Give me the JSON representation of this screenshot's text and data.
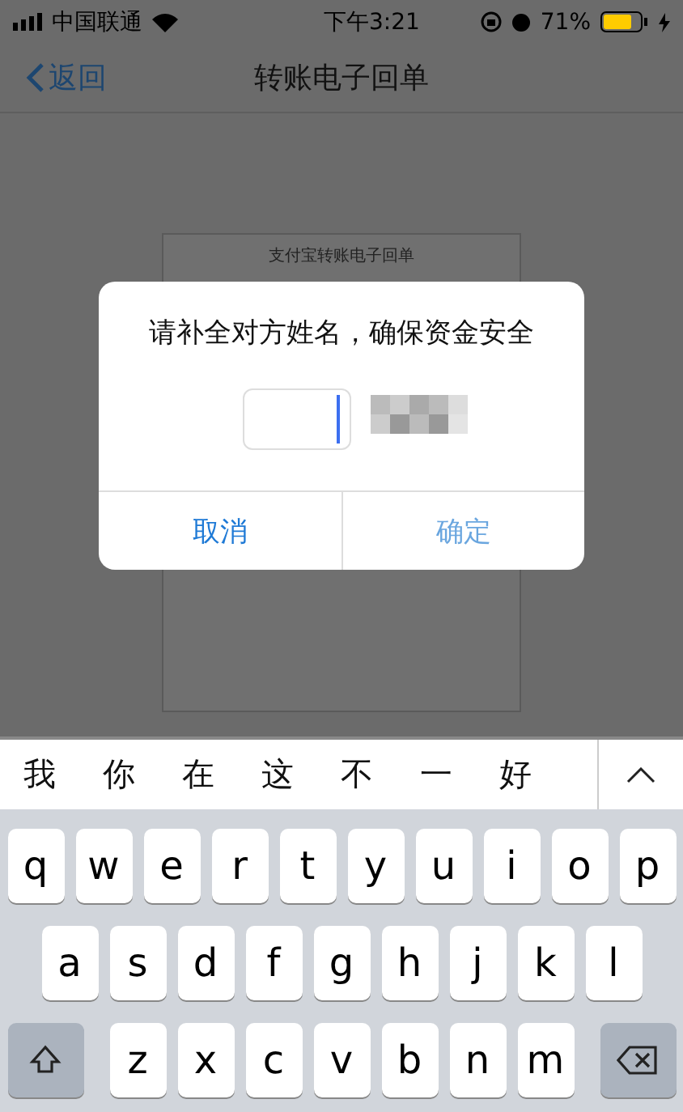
{
  "status_bar": {
    "carrier": "中国联通",
    "time": "下午3:21",
    "battery": "71%"
  },
  "nav": {
    "back": "返回",
    "title": "转账电子回单"
  },
  "document": {
    "title": "支付宝转账电子回单"
  },
  "dialog": {
    "message": "请补全对方姓名，确保资金安全",
    "buttons": [
      {
        "label": "取消",
        "disabled": false
      },
      {
        "label": "确定",
        "disabled": true
      }
    ]
  },
  "keyboard": {
    "candidates": [
      "我",
      "你",
      "在",
      "这",
      "不",
      "一",
      "好"
    ],
    "rows": [
      [
        "q",
        "w",
        "e",
        "r",
        "t",
        "y",
        "u",
        "i",
        "o",
        "p"
      ],
      [
        "a",
        "s",
        "d",
        "f",
        "g",
        "h",
        "j",
        "k",
        "l"
      ],
      [
        "z",
        "x",
        "c",
        "v",
        "b",
        "n",
        "m"
      ]
    ]
  }
}
